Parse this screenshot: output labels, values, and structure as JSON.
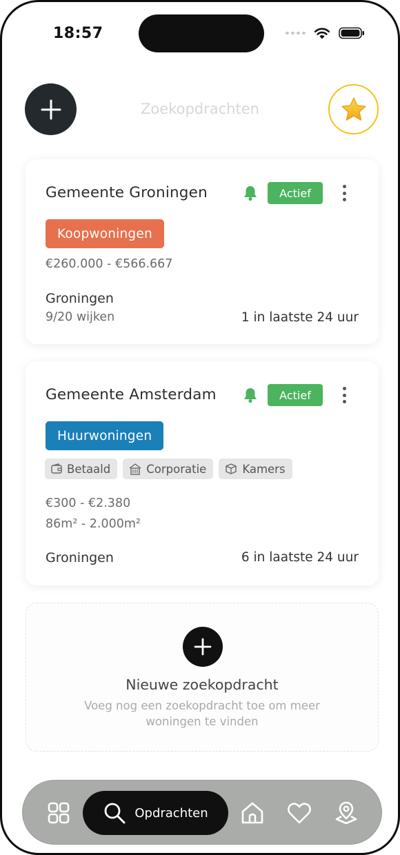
{
  "status_bar": {
    "time": "18:57"
  },
  "header": {
    "title": "Zoekopdrachten",
    "add_icon": "plus-icon",
    "favorites_icon": "star-icon"
  },
  "colors": {
    "active_green": "#4cb35f",
    "koop_orange": "#e7704e",
    "huur_blue": "#1b7fb8",
    "star_gold": "#f0c419"
  },
  "searches": [
    {
      "title": "Gemeente Groningen",
      "status": "Actief",
      "type": "Koopwoningen",
      "price": "€260.000 - €566.667",
      "location": "Groningen",
      "districts": "9/20 wijken",
      "new_count": "1 in laatste 24 uur"
    },
    {
      "title": "Gemeente Amsterdam",
      "status": "Actief",
      "type": "Huurwoningen",
      "tags": [
        {
          "label": "Betaald",
          "icon": "wallet-icon"
        },
        {
          "label": "Corporatie",
          "icon": "building-icon"
        },
        {
          "label": "Kamers",
          "icon": "box-icon"
        }
      ],
      "price": "€300 - €2.380",
      "area": "86m² - 2.000m²",
      "location": "Groningen",
      "new_count": "6 in laatste 24 uur"
    }
  ],
  "new_search": {
    "title": "Nieuwe zoekopdracht",
    "subtitle": "Voeg nog een zoekopdracht toe om meer woningen te vinden"
  },
  "bottom_nav": {
    "active_label": "Opdrachten",
    "items": [
      "grid-icon",
      "search-icon",
      "home-icon",
      "heart-icon",
      "map-pin-icon"
    ]
  }
}
